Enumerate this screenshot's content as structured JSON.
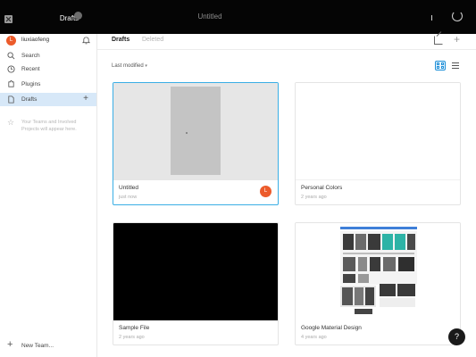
{
  "topbar": {
    "drafts_tab": "Drafts",
    "file_tab": "Untitled"
  },
  "sidebar": {
    "user_name": "liuxiaofeng",
    "user_initial": "L",
    "items": [
      {
        "label": "Search",
        "icon": "search-icon"
      },
      {
        "label": "Recent",
        "icon": "clock-icon"
      },
      {
        "label": "Plugins",
        "icon": "plugin-icon"
      },
      {
        "label": "Drafts",
        "icon": "drafts-icon"
      }
    ],
    "teams_hint": "Your Teams and Involved Projects will appear here.",
    "new_team": "New Team..."
  },
  "main": {
    "tabs": [
      "Drafts",
      "Deleted"
    ],
    "sort_label": "Last modified",
    "files": [
      {
        "title": "Untitled",
        "time": "just now",
        "owner_initial": "L"
      },
      {
        "title": "Personal Colors",
        "time": "2 years ago"
      },
      {
        "title": "Sample File",
        "time": "2 years ago"
      },
      {
        "title": "Google Material Design",
        "time": "4 years ago"
      }
    ]
  },
  "help": {
    "label": "?"
  },
  "colors": {
    "accent": "#3aaee5",
    "selected_nav": "#d7e8f8",
    "avatar": "#ec5b2b"
  }
}
